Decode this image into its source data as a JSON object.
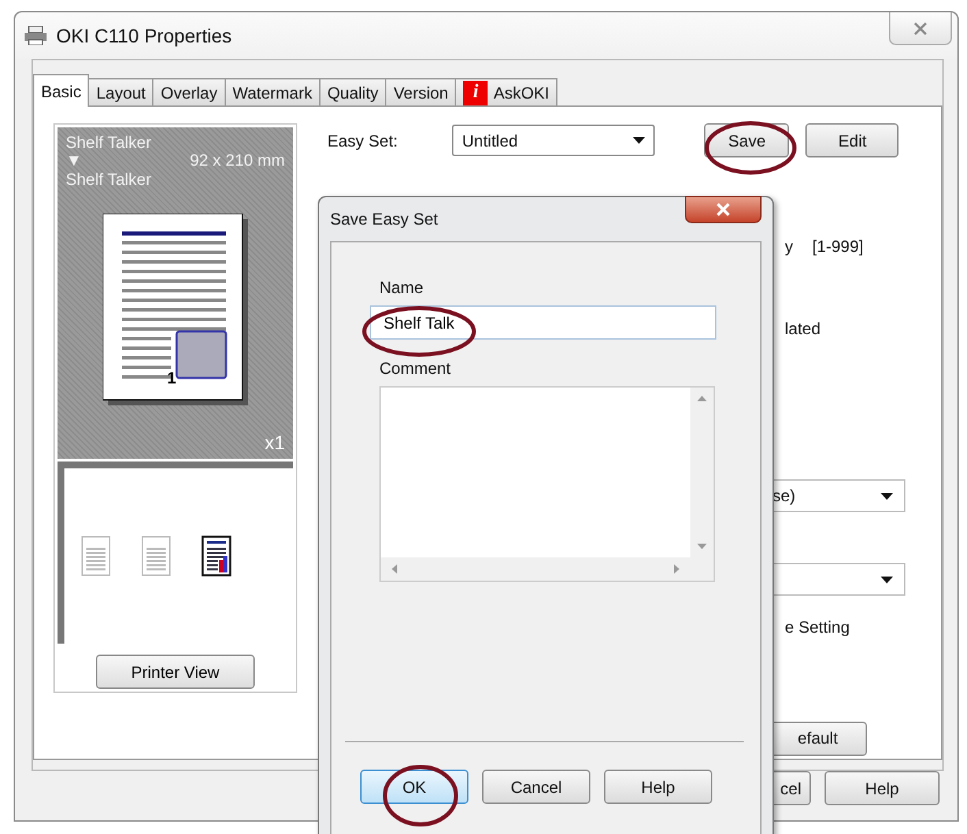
{
  "window": {
    "title": "OKI C110 Properties"
  },
  "tabs": [
    {
      "label": "Basic",
      "selected": true,
      "kind": "plain"
    },
    {
      "label": "Layout",
      "selected": false,
      "kind": "plain"
    },
    {
      "label": "Overlay",
      "selected": false,
      "kind": "plain"
    },
    {
      "label": "Watermark",
      "selected": false,
      "kind": "plain"
    },
    {
      "label": "Quality",
      "selected": false,
      "kind": "plain"
    },
    {
      "label": "Version",
      "selected": false,
      "kind": "plain"
    },
    {
      "label": "AskOKI",
      "selected": false,
      "kind": "info",
      "icon": "i"
    }
  ],
  "preview": {
    "paper_from": "Shelf Talker",
    "arrow": "▼",
    "paper_to": "Shelf Talker",
    "size": "92 x 210 mm",
    "page_number": "1",
    "copies": "x1",
    "view_modes": [
      {
        "selected": false
      },
      {
        "selected": false
      },
      {
        "selected": true
      }
    ],
    "button": "Printer View"
  },
  "easy_set": {
    "label": "Easy Set:",
    "value": "Untitled",
    "buttons": [
      "Save",
      "Edit"
    ]
  },
  "settings": {
    "copies_label": "y",
    "copies_range": "[1-999]",
    "collate_label": "lated",
    "dropdown_1": "se)",
    "setting_label": "e Setting",
    "default_button": "efault"
  },
  "footer_buttons": [
    "cel",
    "Help"
  ],
  "dialog": {
    "title": "Save Easy Set",
    "name_label": "Name",
    "name_value": "Shelf Talk",
    "comment_label": "Comment",
    "buttons": [
      {
        "label": "OK",
        "default": true
      },
      {
        "label": "Cancel",
        "default": false
      },
      {
        "label": "Help",
        "default": false
      }
    ]
  }
}
